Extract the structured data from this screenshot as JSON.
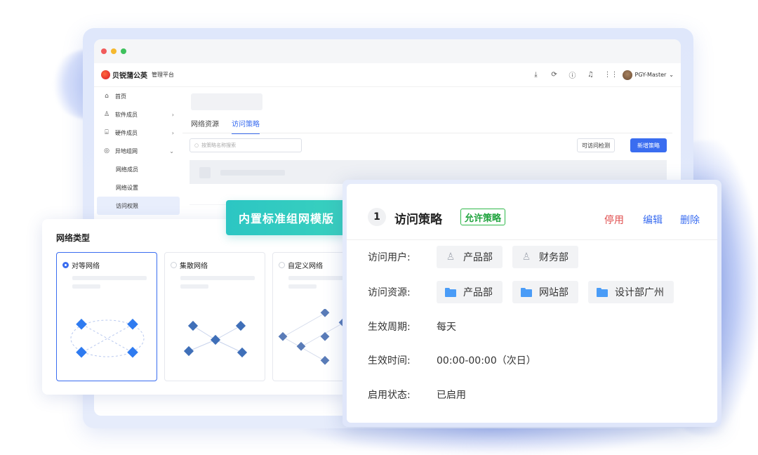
{
  "window": {
    "logo_text": "贝锐蒲公英",
    "platform": "管理平台",
    "user": "PGY-Master",
    "icons": [
      "download-icon",
      "refresh-icon",
      "help-icon",
      "bell-icon",
      "grid-icon"
    ]
  },
  "sidebar": {
    "items": [
      {
        "label": "首页",
        "icon": "home-icon"
      },
      {
        "label": "软件成员",
        "icon": "user-icon"
      },
      {
        "label": "硬件成员",
        "icon": "device-icon"
      },
      {
        "label": "异地组网",
        "icon": "network-icon"
      },
      {
        "label": "网络成员"
      },
      {
        "label": "网络设置"
      },
      {
        "label": "访问权限"
      }
    ]
  },
  "main": {
    "tabs": [
      "网络资源",
      "访问策略"
    ],
    "active_tab": "访问策略",
    "search_placeholder": "按策略名称搜索",
    "check_button": "可访问检测",
    "add_button": "新增策略"
  },
  "banner": "内置标准组网模版",
  "network_type": {
    "title": "网络类型",
    "options": [
      {
        "label": "对等网络",
        "selected": true
      },
      {
        "label": "集散网络",
        "selected": false
      },
      {
        "label": "自定义网络",
        "selected": false
      }
    ]
  },
  "policy": {
    "number": "1",
    "title": "访问策略",
    "badge": "允许策略",
    "actions": {
      "disable": "停用",
      "edit": "编辑",
      "delete": "删除"
    },
    "rows": {
      "users_label": "访问用户:",
      "users": [
        "产品部",
        "财务部"
      ],
      "resources_label": "访问资源:",
      "resources": [
        "产品部",
        "网站部",
        "设计部广州"
      ],
      "period_label": "生效周期:",
      "period": "每天",
      "time_label": "生效时间:",
      "time": "00:00-00:00（次日）",
      "status_label": "启用状态:",
      "status": "已启用"
    }
  },
  "colors": {
    "accent": "#3a6df0",
    "allow_green": "#1fa33d",
    "disable_red": "#e04e4e",
    "banner_teal": "#2cc6c3"
  }
}
